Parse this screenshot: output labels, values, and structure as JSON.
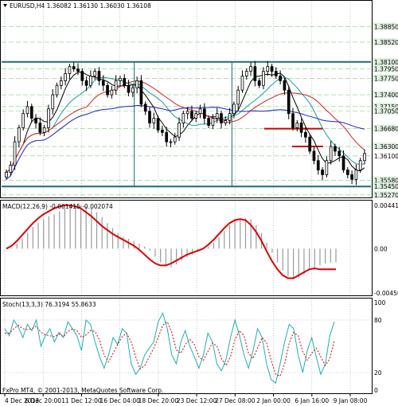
{
  "chart_data": [
    {
      "type": "candlestick",
      "header": "EURUSD,H4  1.36082 1.36130 1.36030 1.36108",
      "symbol": "EURUSD,H4",
      "ohlc_last": {
        "open": 1.36082,
        "high": 1.3613,
        "low": 1.3603,
        "close": 1.36108
      },
      "ylim": [
        1.3525,
        1.3918
      ],
      "ytick_labels": [
        "1.38850",
        "1.38520",
        "1.38100",
        "1.37950",
        "1.37750",
        "1.37400",
        "1.37150",
        "1.37050",
        "1.36680",
        "1.36300",
        "1.36100",
        "1.35580",
        "1.35450",
        "1.35270"
      ],
      "yticks": [
        1.3885,
        1.3852,
        1.381,
        1.3795,
        1.3775,
        1.374,
        1.3715,
        1.3705,
        1.3668,
        1.363,
        1.361,
        1.3558,
        1.3545,
        1.3527
      ],
      "xtick_labels": [
        "4 Dec 2013",
        "6 Dec 20:00",
        "11 Dec 12:00",
        "16 Dec 04:00",
        "18 Dec 20:00",
        "23 Dec 12:00",
        "27 Dec 08:00",
        "2 Jan 00:00",
        "6 Jan 16:00",
        "9 Jan 08:00"
      ],
      "horizontal_levels": [
        {
          "price": 1.381,
          "color": "#1a6e6e",
          "style": "solid-thick"
        },
        {
          "price": 1.3545,
          "color": "#1a6e6e",
          "style": "solid-thick"
        },
        {
          "price": 1.3668,
          "color": "#cc0000",
          "style": "segment"
        },
        {
          "price": 1.363,
          "color": "#cc0000",
          "style": "segment"
        }
      ],
      "price_closes": [
        1.3575,
        1.359,
        1.364,
        1.367,
        1.37,
        1.3715,
        1.369,
        1.368,
        1.366,
        1.367,
        1.371,
        1.374,
        1.376,
        1.377,
        1.3785,
        1.38,
        1.3795,
        1.379,
        1.377,
        1.376,
        1.378,
        1.379,
        1.377,
        1.376,
        1.374,
        1.375,
        1.377,
        1.3775,
        1.376,
        1.3745,
        1.3755,
        1.377,
        1.372,
        1.3705,
        1.368,
        1.369,
        1.3665,
        1.366,
        1.364,
        1.364,
        1.365,
        1.368,
        1.37,
        1.3705,
        1.369,
        1.37,
        1.371,
        1.369,
        1.3675,
        1.369,
        1.37,
        1.368,
        1.3685,
        1.37,
        1.372,
        1.375,
        1.378,
        1.379,
        1.38,
        1.377,
        1.376,
        1.379,
        1.38,
        1.379,
        1.378,
        1.377,
        1.375,
        1.37,
        1.367,
        1.368,
        1.366,
        1.365,
        1.362,
        1.36,
        1.358,
        1.357,
        1.36,
        1.363,
        1.362,
        1.361,
        1.358,
        1.357,
        1.356,
        1.358,
        1.36,
        1.3615
      ],
      "indicator_colors": {
        "ema_fast": "#1a9e9e",
        "ma_black": "#000000",
        "ma_red": "#d62020",
        "ma_blue": "#2020c8",
        "ma_green": "#30c060"
      }
    },
    {
      "type": "bar",
      "header": "MACD(12,26,9) -0.001415 -0.002074",
      "ylim": [
        -0.0045,
        0.0044
      ],
      "ytick_labels": [
        "0.004411",
        "0.00",
        "-0.004501"
      ],
      "yticks": [
        0.004411,
        0.0,
        -0.004501
      ],
      "histogram": [
        0.0,
        0.0001,
        0.0005,
        0.001,
        0.0016,
        0.0022,
        0.0026,
        0.003,
        0.0033,
        0.0035,
        0.0038,
        0.0041,
        0.0043,
        0.0044,
        0.0044,
        0.0043,
        0.0041,
        0.0037,
        0.0032,
        0.0026,
        0.0021,
        0.0016,
        0.0012,
        0.001,
        0.0008,
        0.0005,
        0.0002,
        -0.0002,
        -0.0008,
        -0.0014,
        -0.0018,
        -0.0019,
        -0.0016,
        -0.0012,
        -0.0009,
        -0.0006,
        -0.0003,
        -0.0001,
        0.0002,
        0.0006,
        0.0012,
        0.0018,
        0.0024,
        0.0028,
        0.003,
        0.0031,
        0.003,
        0.0024,
        0.0016,
        0.0006,
        -0.0004,
        -0.0014,
        -0.0022,
        -0.0028,
        -0.0031,
        -0.003,
        -0.0026,
        -0.0022,
        -0.0019,
        -0.0017,
        -0.0015,
        -0.0014,
        -0.0014
      ],
      "signal": [
        0.0,
        0.0003,
        0.0008,
        0.0014,
        0.002,
        0.0026,
        0.0031,
        0.0035,
        0.0038,
        0.0041,
        0.0043,
        0.0044,
        0.0044,
        0.0043,
        0.0041,
        0.0037,
        0.0033,
        0.0028,
        0.0023,
        0.0019,
        0.0015,
        0.0012,
        0.0009,
        0.0006,
        0.0003,
        -0.0001,
        -0.0006,
        -0.0011,
        -0.0015,
        -0.0017,
        -0.0017,
        -0.0015,
        -0.0012,
        -0.0009,
        -0.0006,
        -0.0004,
        -0.0002,
        0.0,
        0.0004,
        0.0009,
        0.0015,
        0.0021,
        0.0026,
        0.0029,
        0.003,
        0.0029,
        0.0024,
        0.0017,
        0.0008,
        -0.0003,
        -0.0013,
        -0.0021,
        -0.0027,
        -0.003,
        -0.003,
        -0.0027,
        -0.0024,
        -0.0021,
        -0.002,
        -0.0021,
        -0.0021,
        -0.0021,
        -0.0021
      ],
      "colors": {
        "histogram": "#9a9a9a",
        "signal": "#dd0000"
      }
    },
    {
      "type": "line",
      "header": "Stoch(13,3,3) 76.3194 55.8633",
      "ylim": [
        0,
        100
      ],
      "ytick_labels": [
        "100",
        "80",
        "20",
        "0"
      ],
      "yticks": [
        100,
        80,
        20,
        0
      ],
      "main": [
        70,
        62,
        80,
        72,
        60,
        75,
        68,
        80,
        50,
        62,
        70,
        55,
        66,
        60,
        78,
        70,
        62,
        45,
        80,
        75,
        55,
        38,
        25,
        40,
        60,
        52,
        70,
        65,
        30,
        18,
        25,
        40,
        48,
        55,
        78,
        88,
        70,
        40,
        30,
        55,
        68,
        50,
        38,
        25,
        40,
        65,
        55,
        30,
        22,
        35,
        60,
        80,
        62,
        40,
        25,
        45,
        70,
        60,
        30,
        12,
        8,
        30,
        55,
        75,
        70,
        40,
        20,
        45,
        60,
        38,
        18,
        30,
        62,
        78
      ],
      "signal": [
        65,
        65,
        70,
        74,
        70,
        69,
        70,
        73,
        66,
        63,
        62,
        61,
        64,
        61,
        67,
        70,
        68,
        60,
        63,
        68,
        67,
        57,
        40,
        32,
        42,
        52,
        61,
        65,
        55,
        38,
        24,
        28,
        38,
        48,
        60,
        74,
        78,
        66,
        46,
        42,
        52,
        58,
        52,
        38,
        34,
        44,
        54,
        50,
        36,
        28,
        38,
        58,
        68,
        62,
        42,
        36,
        48,
        60,
        54,
        34,
        18,
        16,
        30,
        54,
        66,
        62,
        44,
        34,
        42,
        48,
        38,
        28,
        36,
        56
      ],
      "colors": {
        "main": "#20b0b0",
        "signal": "#dd0000"
      }
    }
  ],
  "footer": "FxPro MT4, © 2001-2013, MetaQuotes Software Corp."
}
